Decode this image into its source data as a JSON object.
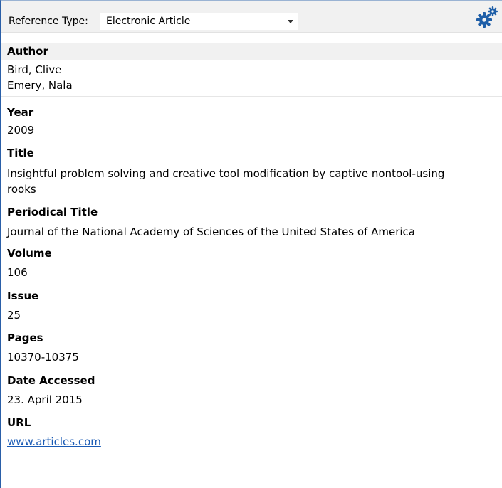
{
  "toolbar": {
    "ref_type_label": "Reference Type:",
    "ref_type_value": "Electronic Article",
    "settings_icon": "gears-icon",
    "accent_color": "#2a5fa8"
  },
  "fields": {
    "author": {
      "label": "Author",
      "values": [
        "Bird, Clive",
        "Emery, Nala"
      ]
    },
    "year": {
      "label": "Year",
      "value": "2009"
    },
    "title": {
      "label": "Title",
      "line1": "Insightful problem solving and creative tool modification by captive nontool-using",
      "line2": "rooks"
    },
    "periodical": {
      "label": "Periodical Title",
      "value": "Journal of the National Academy of Sciences of the United States of America"
    },
    "volume": {
      "label": "Volume",
      "value": "106"
    },
    "issue": {
      "label": "Issue",
      "value": "25"
    },
    "pages": {
      "label": "Pages",
      "value": "10370-10375"
    },
    "date_accessed": {
      "label": "Date Accessed",
      "value": "23. April 2015"
    },
    "url": {
      "label": "URL",
      "value": "www.articles.com"
    }
  }
}
